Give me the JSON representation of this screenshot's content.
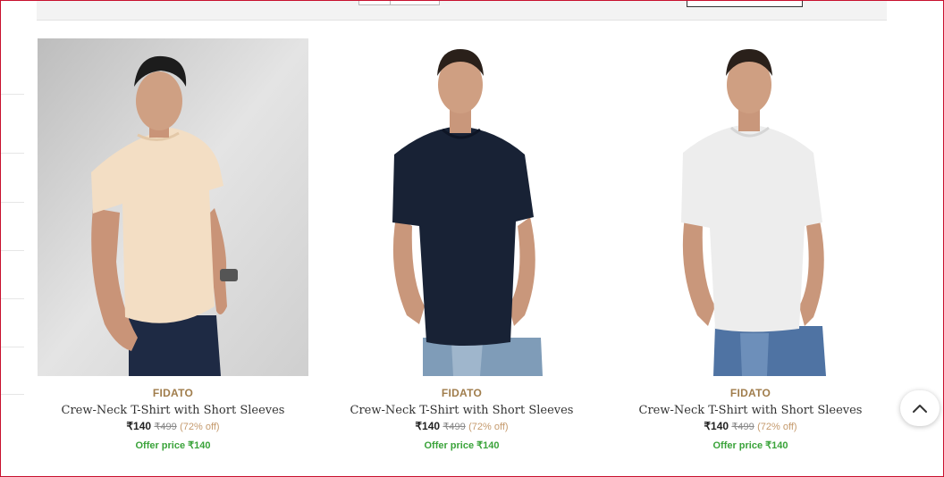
{
  "products": [
    {
      "brand": "FIDATO",
      "name": "Crew-Neck T-Shirt with Short Sleeves",
      "price": "₹140",
      "mrp": "₹499",
      "discount": "(72% off)",
      "offer": "Offer price ₹140",
      "shirt_color": "#f3dec4",
      "bg_color": "#d6d6d6"
    },
    {
      "brand": "FIDATO",
      "name": "Crew-Neck T-Shirt with Short Sleeves",
      "price": "₹140",
      "mrp": "₹499",
      "discount": "(72% off)",
      "offer": "Offer price ₹140",
      "shirt_color": "#182235",
      "bg_color": "#ffffff"
    },
    {
      "brand": "FIDATO",
      "name": "Crew-Neck T-Shirt with Short Sleeves",
      "price": "₹140",
      "mrp": "₹499",
      "discount": "(72% off)",
      "offer": "Offer price ₹140",
      "shirt_color": "#ededed",
      "bg_color": "#ffffff"
    }
  ],
  "scroll_top_icon": "chevron-up-icon",
  "colors": {
    "brand": "#a07d4c",
    "offer": "#3aa33a",
    "discount": "#c59a6d",
    "frame_border": "#c8102e"
  }
}
